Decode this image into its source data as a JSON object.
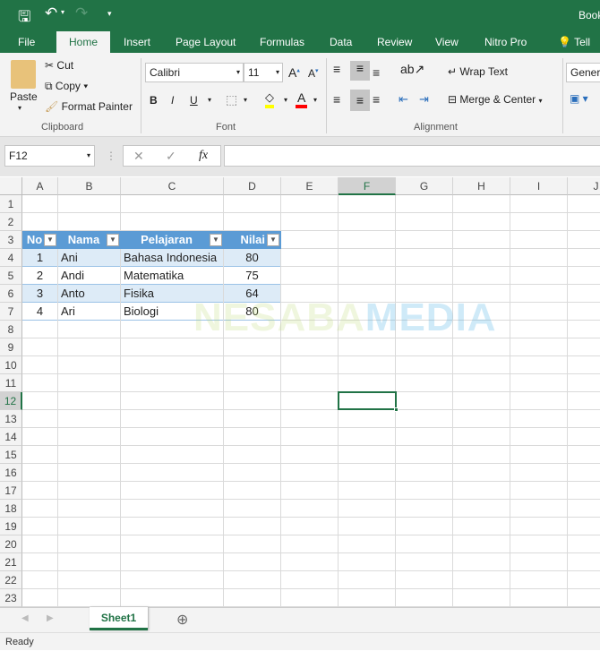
{
  "title_bar": {
    "title": "Book",
    "save_icon": "save-icon",
    "undo_icon": "undo-icon",
    "redo_icon": "redo-icon"
  },
  "tabs": [
    "File",
    "Home",
    "Insert",
    "Page Layout",
    "Formulas",
    "Data",
    "Review",
    "View",
    "Nitro Pro",
    "Tell me"
  ],
  "ribbon": {
    "clipboard": {
      "paste": "Paste",
      "cut": "Cut",
      "copy": "Copy",
      "format_painter": "Format Painter",
      "label": "Clipboard"
    },
    "font": {
      "name": "Calibri",
      "size": "11",
      "bold": "B",
      "italic": "I",
      "underline": "U",
      "label": "Font",
      "fill_color": "#ffff00",
      "font_color": "#ff0000"
    },
    "alignment": {
      "wrap": "Wrap Text",
      "merge": "Merge & Center",
      "label": "Alignment"
    },
    "number": {
      "format": "General"
    }
  },
  "formula_bar": {
    "name_box": "F12",
    "cancel": "✕",
    "enter": "✓",
    "fx": "fx",
    "value": ""
  },
  "columns": [
    "A",
    "B",
    "C",
    "D",
    "E",
    "F",
    "G",
    "H",
    "I",
    "J"
  ],
  "rows": [
    "1",
    "2",
    "3",
    "4",
    "5",
    "6",
    "7",
    "8",
    "9",
    "10",
    "11",
    "12",
    "13",
    "14",
    "15",
    "16",
    "17",
    "18",
    "19",
    "20",
    "21",
    "22",
    "23"
  ],
  "table": {
    "headers": [
      "No",
      "Nama",
      "Pelajaran",
      "Nilai"
    ],
    "rows": [
      [
        "1",
        "Ani",
        "Bahasa Indonesia",
        "80"
      ],
      [
        "2",
        "Andi",
        "Matematika",
        "75"
      ],
      [
        "3",
        "Anto",
        "Fisika",
        "64"
      ],
      [
        "4",
        "Ari",
        "Biologi",
        "80"
      ]
    ]
  },
  "watermark": "NESABAMEDIA",
  "selected_cell": "F12",
  "sheet_tabs": [
    "Sheet1"
  ],
  "status": "Ready"
}
